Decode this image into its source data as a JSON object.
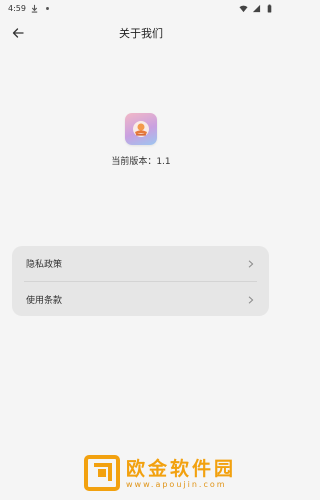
{
  "status_bar": {
    "time": "4:59"
  },
  "header": {
    "title": "关于我们"
  },
  "app": {
    "version_text": "当前版本：1.1"
  },
  "menu": {
    "items": [
      {
        "label": "隐私政策"
      },
      {
        "label": "使用条款"
      }
    ]
  },
  "watermark": {
    "name": "欧金软件园",
    "url": "www.apoujin.com"
  },
  "icons": {
    "back": "arrow-left-icon",
    "chevron": "chevron-right-icon",
    "app_logo": "app-logo-icon"
  },
  "colors": {
    "card_bg": "#e6e6e6",
    "background": "#f5f5f5",
    "watermark": "#f2a10f"
  }
}
